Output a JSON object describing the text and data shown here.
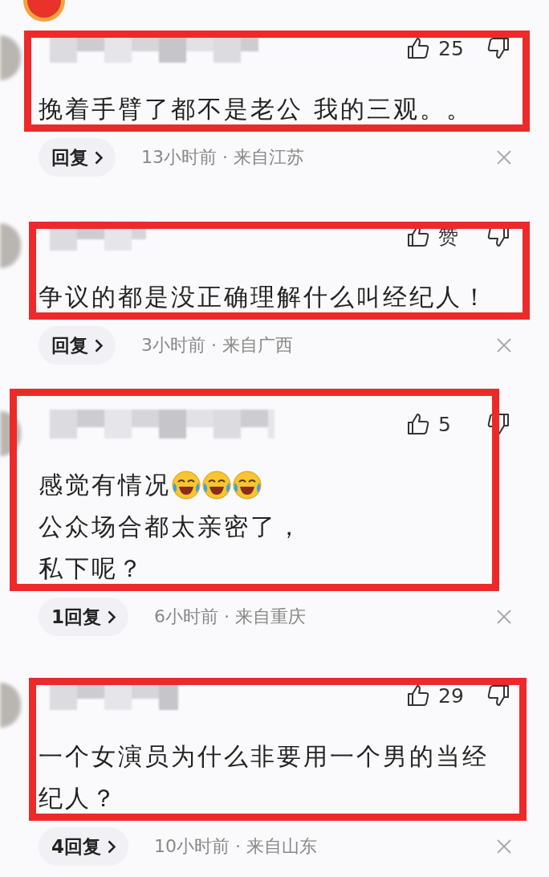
{
  "comments": [
    {
      "likes": "25",
      "lines": [
        "挽着手臂了都不是老公 我的三观。。"
      ],
      "replies": "回复",
      "time": "13小时前 · 来自江苏",
      "highlighted": true
    },
    {
      "likes": "赞",
      "lines": [
        "争议的都是没正确理解什么叫经纪人！"
      ],
      "replies": "回复",
      "time": "3小时前 · 来自广西",
      "highlighted": true
    },
    {
      "likes": "5",
      "lines": [
        "感觉有情况",
        "公众场合都太亲密了，",
        "私下呢？"
      ],
      "emojis": [
        {
          "kind": "laughing-crying"
        },
        {
          "kind": "laughing-crying"
        },
        {
          "kind": "laughing-crying"
        }
      ],
      "replies": "1回复",
      "time": "6小时前 · 来自重庆",
      "highlighted": true
    },
    {
      "likes": "29",
      "lines": [
        "一个女演员为什么非要用一个男的当经",
        "纪人？"
      ],
      "replies": "4回复",
      "time": "10小时前 · 来自山东",
      "highlighted": true
    }
  ]
}
